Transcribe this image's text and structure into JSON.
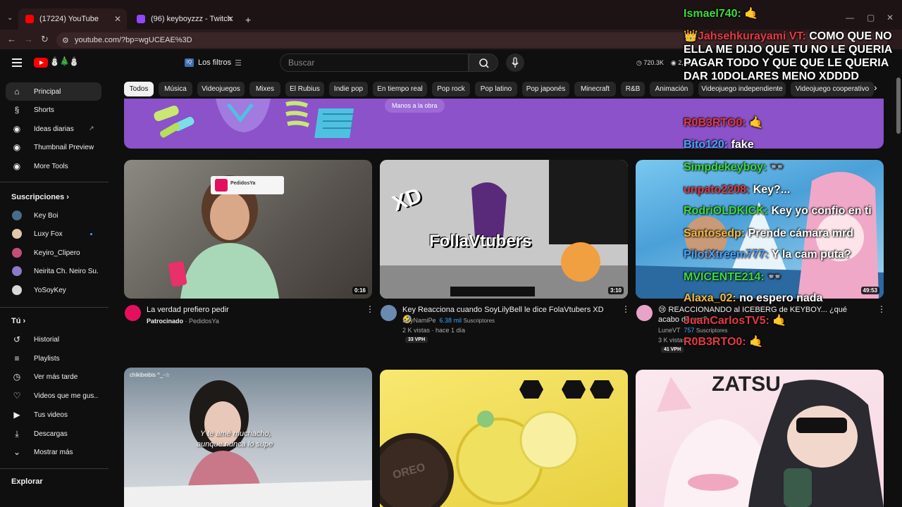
{
  "browser": {
    "tabs": [
      {
        "title": "(17224) YouTube",
        "active": true,
        "color": "#ff0000"
      },
      {
        "title": "(96) keyboyzzz - Twitch",
        "active": false,
        "color": "#9146ff"
      }
    ],
    "url": "youtube.com/?bp=wgUCEAE%3D"
  },
  "header": {
    "filters_label": "Los filtros",
    "search_placeholder": "Buscar",
    "stats": [
      "720.3K",
      "2,407"
    ]
  },
  "sidebar": {
    "main": [
      {
        "label": "Principal",
        "icon": "home-icon",
        "glyph": "⌂",
        "active": true
      },
      {
        "label": "Shorts",
        "icon": "shorts-icon",
        "glyph": "§"
      },
      {
        "label": "Ideas diarias",
        "icon": "extension-icon",
        "glyph": "◉"
      },
      {
        "label": "Thumbnail Preview",
        "icon": "extension-icon",
        "glyph": "◉"
      },
      {
        "label": "More Tools",
        "icon": "extension-icon",
        "glyph": "◉"
      }
    ],
    "subs_title": "Suscripciones",
    "subs": [
      {
        "label": "Key Boi",
        "color": "#4a6b8a"
      },
      {
        "label": "Luxy Fox",
        "color": "#e0c8a8"
      },
      {
        "label": "Keyiro_Clipero",
        "color": "#c44d7a"
      },
      {
        "label": "Neirita Ch. Neiro Su...",
        "color": "#8a7ac8"
      },
      {
        "label": "YoSoyKey",
        "color": "#d8d8d8"
      }
    ],
    "you_title": "Tú",
    "you": [
      {
        "label": "Historial",
        "icon": "history-icon",
        "glyph": "↺"
      },
      {
        "label": "Playlists",
        "icon": "playlist-icon",
        "glyph": "≡"
      },
      {
        "label": "Ver más tarde",
        "icon": "watch-later-icon",
        "glyph": "◷"
      },
      {
        "label": "Videos que me gus...",
        "icon": "like-icon",
        "glyph": "👍"
      },
      {
        "label": "Tus videos",
        "icon": "your-videos-icon",
        "glyph": "▶"
      },
      {
        "label": "Descargas",
        "icon": "download-icon",
        "glyph": "⤓"
      },
      {
        "label": "Mostrar más",
        "icon": "chevron-down-icon",
        "glyph": "⌄"
      }
    ],
    "explore_title": "Explorar"
  },
  "chips": [
    "Todos",
    "Música",
    "Videojuegos",
    "Mixes",
    "El Rubius",
    "Indie pop",
    "En tiempo real",
    "Pop rock",
    "Pop latino",
    "Pop japonés",
    "Minecraft",
    "R&B",
    "Animación",
    "Videojuego independiente",
    "Videojuego cooperativo"
  ],
  "banner": {
    "button_label": "Manos a la obra"
  },
  "videos": [
    {
      "title": "La verdad prefiero pedir",
      "duration": "0:16",
      "channel": "PedidosYa",
      "sponsored": "Patrocinado",
      "avatar_color": "#e5105d",
      "thumb_label": "PedidosYa"
    },
    {
      "title": "Key Reacciona cuando SoyLilyBell le dice FolaVtubers XD 🤣",
      "duration": "3:10",
      "channel": "SoyNamiPe",
      "subs": "6.38 mil",
      "subs_suffix": "Suscriptores",
      "views": "2 K vistas · hace 1 día",
      "vph": "33 VPH",
      "avatar_color": "#6a8bb0",
      "thumb_text": "FollaVtubers",
      "thumb_xd": "XD"
    },
    {
      "title": "😢 REACCIONANDO al ICEBERG de KEYBOY... ¿qué acabo de ver?",
      "duration": "49:53",
      "channel": "LuneVT",
      "subs": "757",
      "subs_suffix": "Suscriptores",
      "views": "3 K vistas",
      "vph": "41 VPH",
      "avatar_color": "#e8a4c8"
    },
    {
      "thumb_text": "chikibeibis ^_-☆",
      "thumb_lyric_1": "Y te amé muchacho,",
      "thumb_lyric_2": "aunque nunca lo supe"
    },
    {
      "thumb_brand": "OREO"
    },
    {
      "thumb_text": "ZATSU"
    }
  ],
  "chat": [
    {
      "name": "Ismael740:",
      "msg": "",
      "color": "green"
    },
    {
      "name": "👑Jahsehkurayami VT:",
      "msg": "COMO QUE NO ELLA ME DIJO QUE TU NO LE QUERIA PAGAR TODO Y QUE QUE LE QUERIA DAR 10DOLARES MENO XDDDD",
      "color": "red"
    },
    {
      "name": "R0B3RTO0:",
      "msg": "",
      "color": "red"
    },
    {
      "name": "Bito120:",
      "msg": "fake",
      "color": "blue"
    },
    {
      "name": "Simpdekeyboy:",
      "msg": "",
      "color": "green"
    },
    {
      "name": "unpato2208:",
      "msg": "Key?...",
      "color": "red"
    },
    {
      "name": "RodriOLDKICK:",
      "msg": "Key yo confio en ti",
      "color": "green"
    },
    {
      "name": "Santosedp:",
      "msg": "Prende cámara mrd",
      "color": "yellow"
    },
    {
      "name": "PilotXtreem777:",
      "msg": "Y la cam puta?",
      "color": "blue"
    },
    {
      "name": "MVICENTE214:",
      "msg": "",
      "color": "green"
    },
    {
      "name": "Alaxa_02:",
      "msg": "no espero nada",
      "color": "yellow"
    },
    {
      "name": "JuanCarlosTV5:",
      "msg": "",
      "color": "red"
    },
    {
      "name": "R0B3RTO0:",
      "msg": "",
      "color": "red"
    }
  ]
}
